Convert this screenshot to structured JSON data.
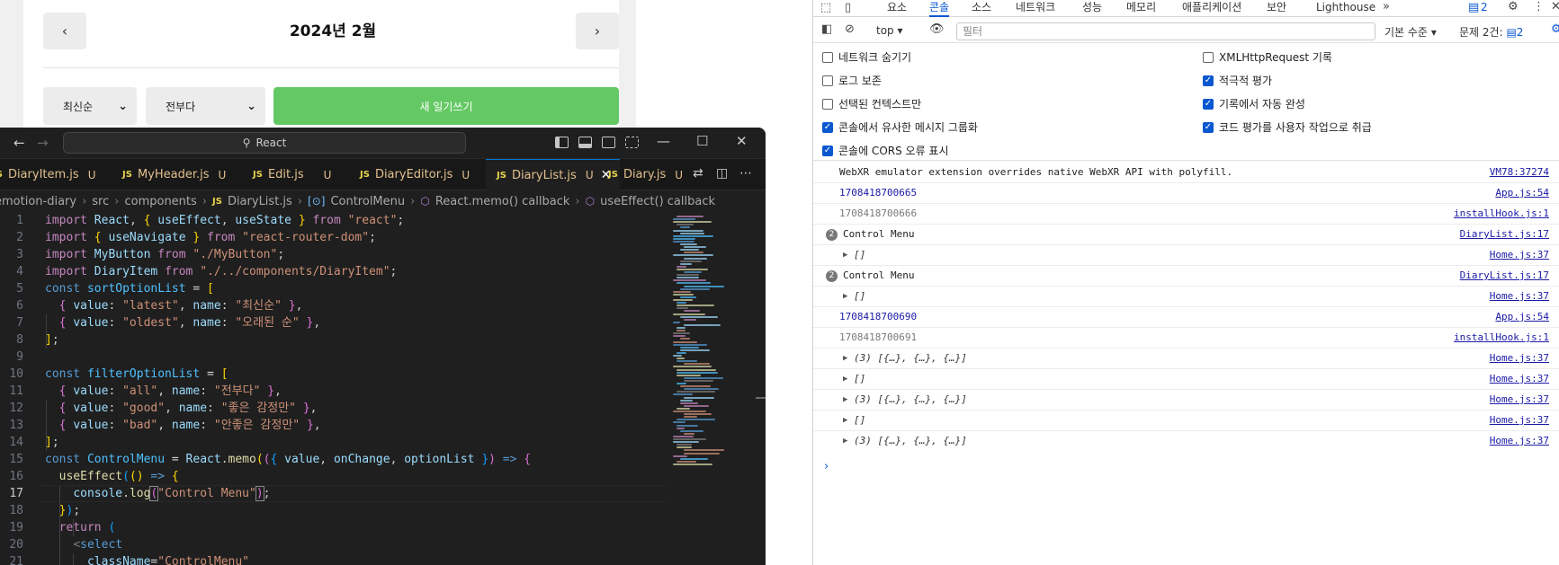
{
  "app": {
    "month_title": "2024년 2월",
    "prev_label": "‹",
    "next_label": "›",
    "sort_value": "최신순",
    "filter_value": "전부다",
    "new_button": "새 일기쓰기"
  },
  "vscode": {
    "search_text": "React",
    "tabs": [
      {
        "name": "DiaryItem.js",
        "status": "U"
      },
      {
        "name": "MyHeader.js",
        "status": "U"
      },
      {
        "name": "Edit.js",
        "status": "U"
      },
      {
        "name": "DiaryEditor.js",
        "status": "U"
      },
      {
        "name": "DiaryList.js",
        "status": "U"
      },
      {
        "name": "Diary.js",
        "status": "U"
      }
    ],
    "js_badge": "JS",
    "breadcrumb": {
      "project": "emotion-diary",
      "src": "src",
      "components": "components",
      "file": "DiaryList.js",
      "symbol1": "ControlMenu",
      "symbol2": "React.memo() callback",
      "symbol3": "useEffect() callback"
    },
    "line_numbers": [
      "1",
      "2",
      "3",
      "4",
      "5",
      "6",
      "7",
      "8",
      "9",
      "10",
      "11",
      "12",
      "13",
      "14",
      "15",
      "16",
      "17",
      "18",
      "19",
      "20",
      "21"
    ]
  },
  "devtools": {
    "tabs": [
      "요소",
      "콘솔",
      "소스",
      "네트워크",
      "성능",
      "메모리",
      "애플리케이션",
      "보안",
      "Lighthouse"
    ],
    "active_tab": "콘솔",
    "issues_badge": "2",
    "context": "top",
    "filter_placeholder": "필터",
    "level": "기본 수준",
    "issues_label": "문제 2건:",
    "issues_count": "2",
    "settings_left": [
      {
        "label": "네트워크 숨기기",
        "checked": false
      },
      {
        "label": "로그 보존",
        "checked": false
      },
      {
        "label": "선택된 컨텍스트만",
        "checked": false
      },
      {
        "label": "콘솔에서 유사한 메시지 그룹화",
        "checked": true
      },
      {
        "label": "콘솔에 CORS 오류 표시",
        "checked": true
      }
    ],
    "settings_right": [
      {
        "label": "XMLHttpRequest 기록",
        "checked": false
      },
      {
        "label": "적극적 평가",
        "checked": true
      },
      {
        "label": "기록에서 자동 완성",
        "checked": true
      },
      {
        "label": "코드 평가를 사용자 작업으로 취급",
        "checked": true
      }
    ],
    "logs": [
      {
        "msg": "WebXR emulator extension overrides native WebXR API with polyfill.",
        "src": "VM78:37274"
      },
      {
        "msg": "1708418700665",
        "src": "App.js:54"
      },
      {
        "msg": "1708418700666",
        "src": "installHook.js:1"
      },
      {
        "msg": "Control Menu",
        "src": "DiaryList.js:17",
        "badge": "2"
      },
      {
        "msg": "[]",
        "src": "Home.js:37"
      },
      {
        "msg": "Control Menu",
        "src": "DiaryList.js:17",
        "badge": "2"
      },
      {
        "msg": "[]",
        "src": "Home.js:37"
      },
      {
        "msg": "1708418700690",
        "src": "App.js:54"
      },
      {
        "msg": "1708418700691",
        "src": "installHook.js:1"
      },
      {
        "msg": "(3) [{…}, {…}, {…}]",
        "src": "Home.js:37"
      },
      {
        "msg": "[]",
        "src": "Home.js:37"
      },
      {
        "msg": "(3) [{…}, {…}, {…}]",
        "src": "Home.js:37"
      },
      {
        "msg": "[]",
        "src": "Home.js:37"
      },
      {
        "msg": "(3) [{…}, {…}, {…}]",
        "src": "Home.js:37"
      }
    ],
    "prompt": "›"
  }
}
